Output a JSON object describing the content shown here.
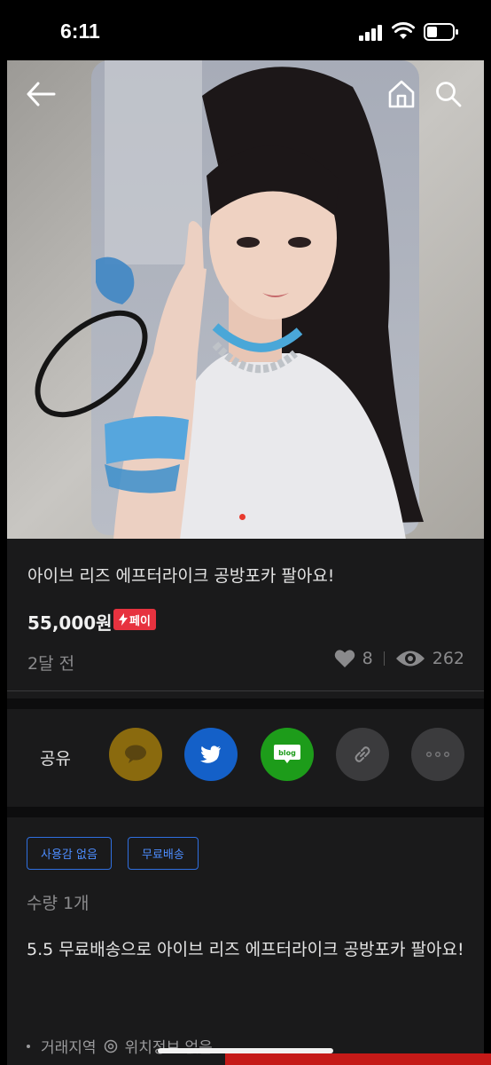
{
  "status_bar": {
    "time": "6:11"
  },
  "listing": {
    "title": "아이브 리즈 에프터라이크 공방포카 팔아요!",
    "price": "55,000원",
    "pay_badge": "페이",
    "time_ago": "2달 전",
    "likes": "8",
    "views": "262"
  },
  "share": {
    "label": "공유",
    "buttons": [
      "kakaotalk",
      "twitter",
      "blog",
      "link",
      "more"
    ],
    "blog_text": "blog"
  },
  "tags": [
    "사용감 없음",
    "무료배송"
  ],
  "quantity": {
    "label": "수량",
    "value": "1개"
  },
  "description": "5.5 무료배송으로 아이브 리즈 에프터라이크 공방포카 팔아요!",
  "meta": {
    "area_label": "거래지역",
    "location": "위치정보 없음"
  },
  "colors": {
    "accent_red": "#e7323f",
    "tag_blue": "#2f6fe0",
    "kakao": "#8a6a0e",
    "twitter": "#1460c8",
    "blog": "#1d9c1a"
  },
  "pager": {
    "current": 1
  }
}
